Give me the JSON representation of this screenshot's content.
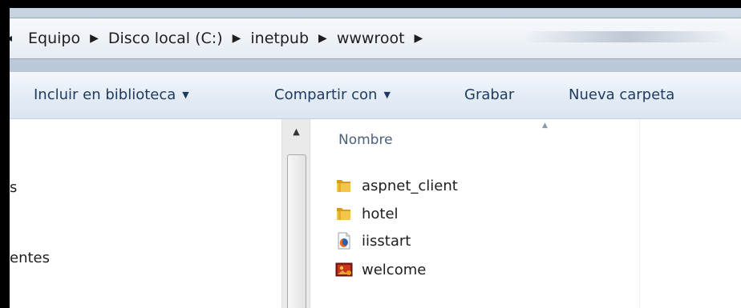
{
  "breadcrumb": {
    "items": [
      "Equipo",
      "Disco local (C:)",
      "inetpub",
      "wwwroot"
    ]
  },
  "toolbar": {
    "include_library": "Incluir en biblioteca",
    "share_with": "Compartir con",
    "burn": "Grabar",
    "new_folder": "Nueva carpeta"
  },
  "nav": {
    "partial_items": [
      "s",
      "entes"
    ]
  },
  "file_list": {
    "column_name": "Nombre",
    "items": [
      {
        "name": "aspnet_client",
        "icon": "folder-icon"
      },
      {
        "name": "hotel",
        "icon": "folder-icon"
      },
      {
        "name": "iisstart",
        "icon": "firefox-html-icon"
      },
      {
        "name": "welcome",
        "icon": "image-file-icon"
      }
    ]
  },
  "colors": {
    "toolbar_text": "#1e3a5f",
    "header_text": "#4c607a",
    "folder": "#e8b23a"
  }
}
